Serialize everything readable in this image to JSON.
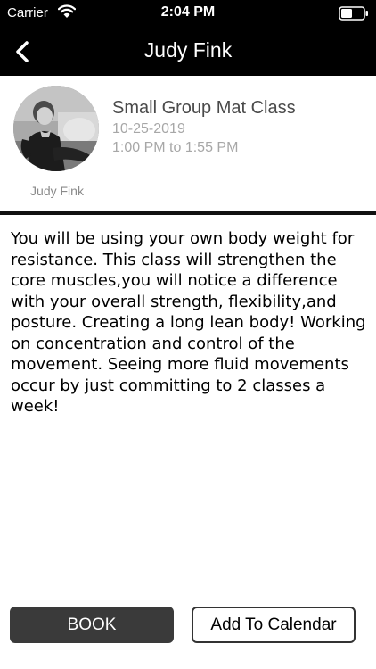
{
  "status_bar": {
    "carrier": "Carrier",
    "time": "2:04 PM",
    "icons": [
      "wifi-icon",
      "battery-icon"
    ]
  },
  "nav": {
    "title": "Judy Fink",
    "back_icon": "chevron-left-icon"
  },
  "class_info": {
    "instructor_name": "Judy Fink",
    "title": "Small Group Mat Class",
    "date": "10-25-2019",
    "time_range": "1:00 PM to 1:55 PM"
  },
  "description": "You will be using your own body weight for resistance. This class will strengthen the core muscles,you will notice a difference with your overall strength, flexibility,and posture. Creating a long lean body! Working on concentration and control of the movement. Seeing more fluid movements occur by just committing to 2 classes a week!",
  "actions": {
    "book_label": "BOOK",
    "calendar_label": "Add To Calendar"
  },
  "colors": {
    "bar_background": "#000000",
    "book_button": "#3a3a3a",
    "muted_text": "#a7a7a7"
  }
}
